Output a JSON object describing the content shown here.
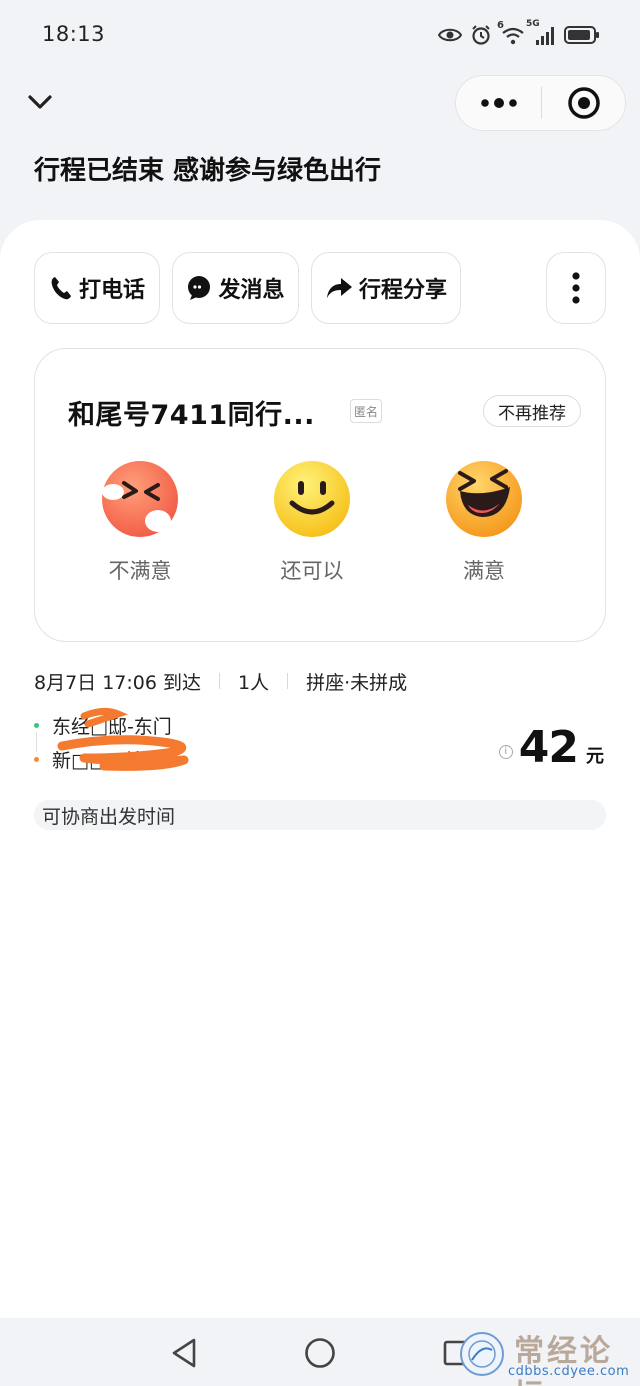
{
  "status_bar": {
    "time": "18:13",
    "icons": [
      "eye-icon",
      "alarm-icon",
      "wifi-icon",
      "signal-5g-icon",
      "battery-icon"
    ],
    "wifi_superscript": "6",
    "network_label": "5G"
  },
  "header": {
    "back_icon": "chevron-down-icon",
    "capsule": {
      "more_icon": "more-dots-icon",
      "close_icon": "target-icon"
    },
    "title": "行程已结束 感谢参与绿色出行"
  },
  "actions": {
    "call": {
      "icon": "phone-icon",
      "label": "打电话"
    },
    "message": {
      "icon": "chat-icon",
      "label": "发消息"
    },
    "share": {
      "icon": "share-arrow-icon",
      "label": "行程分享"
    },
    "more_icon": "kebab-icon"
  },
  "rating": {
    "title": "和尾号7411同行...",
    "anonymous_badge": "匿名",
    "dismiss": "不再推荐",
    "options": [
      {
        "label": "不满意",
        "icon": "angry-face-icon"
      },
      {
        "label": "还可以",
        "icon": "smile-face-icon"
      },
      {
        "label": "满意",
        "icon": "laughing-face-icon"
      }
    ]
  },
  "trip": {
    "arrival": "8月7日 17:06 到达",
    "passengers": "1人",
    "mode": "拼座·未拼成",
    "origin": "东经□邸-东门",
    "destination": "新□□□站",
    "price": "42",
    "price_unit": "元",
    "price_info_icon": "info-icon",
    "negotiable": "可协商出发时间"
  },
  "colors": {
    "origin_dot": "#3cc47c",
    "destination_dot": "#f08a3c",
    "scribble": "#f37a2e"
  },
  "nav": {
    "back_icon": "triangle-back-icon",
    "home_icon": "circle-home-icon",
    "recent_icon": "square-recent-icon"
  },
  "watermark": {
    "text": "常经论坛",
    "url": "cdbbs.cdyee.com"
  }
}
